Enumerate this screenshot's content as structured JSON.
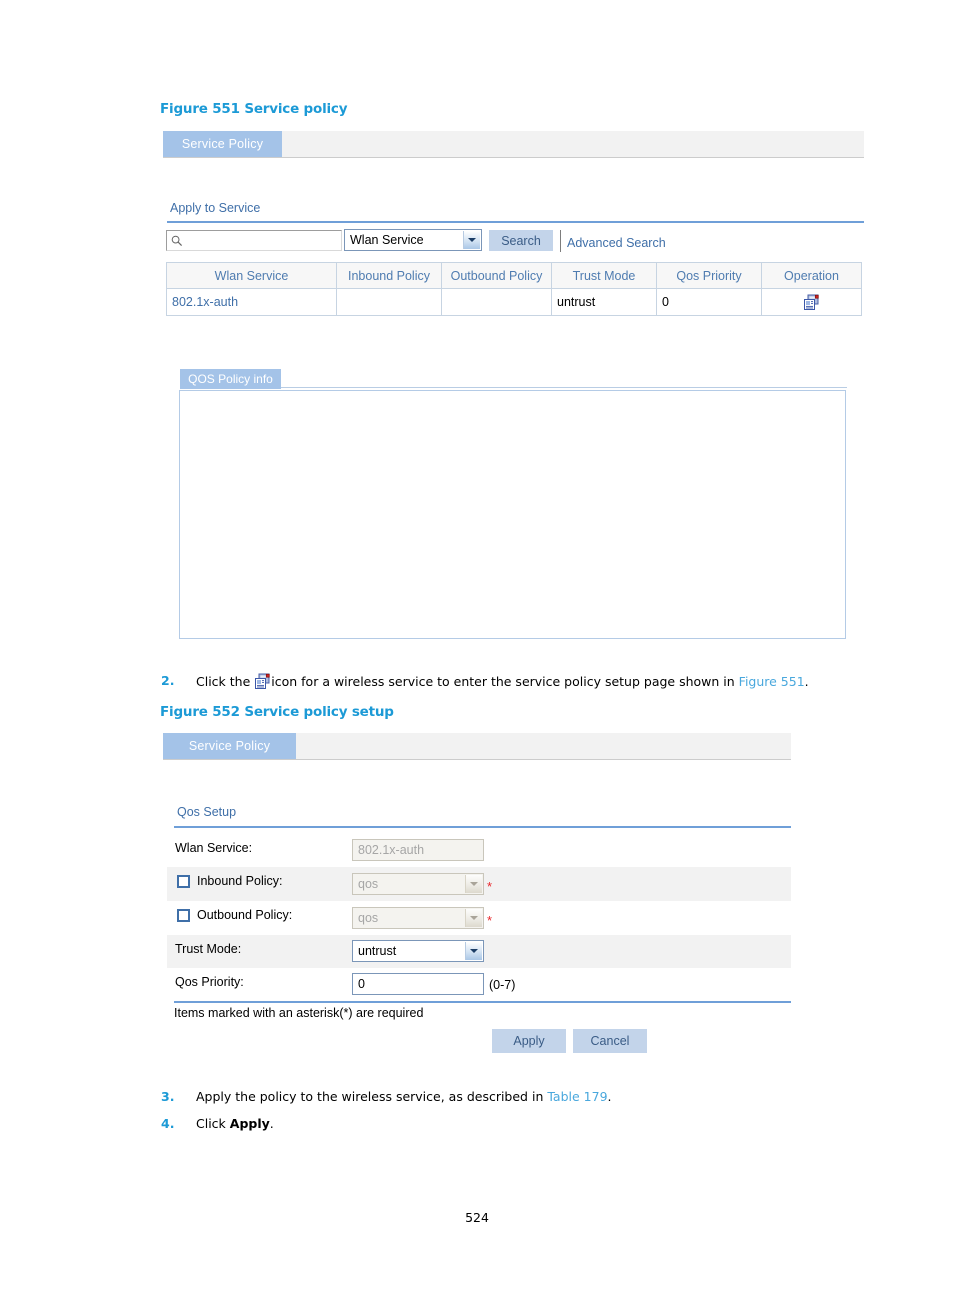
{
  "document": {
    "page_number": "524"
  },
  "figure551": {
    "caption": "Figure 551 Service policy",
    "tab_label": "Service Policy",
    "section_label": "Apply to Service",
    "search": {
      "input_value": "",
      "placeholder": "",
      "search_icon": "search-icon",
      "filter_selected": "Wlan Service",
      "search_button": "Search",
      "advanced_search": "Advanced Search"
    },
    "table": {
      "columns": [
        "Wlan Service",
        "Inbound Policy",
        "Outbound Policy",
        "Trust Mode",
        "Qos Priority",
        "Operation"
      ],
      "rows": [
        {
          "wlan_service": "802.1x-auth",
          "inbound_policy": "",
          "outbound_policy": "",
          "trust_mode": "untrust",
          "qos_priority": "0",
          "operation_icon": "service-policy-setup-icon"
        }
      ]
    },
    "qos_panel": {
      "tab_label": "QOS Policy info",
      "body_text": ""
    }
  },
  "step2": {
    "number": "2.",
    "text_before_icon": "Click the",
    "icon_name": "service-policy-setup-icon",
    "text_after_icon": "icon for a wireless service to enter the service policy setup page shown in",
    "xref": "Figure 551",
    "text_end": "."
  },
  "figure552": {
    "caption": "Figure 552 Service policy setup",
    "tab_label": "Service Policy",
    "section_label": "Qos Setup",
    "fields": [
      {
        "label": "Wlan Service:",
        "type": "text",
        "value": "802.1x-auth",
        "disabled": true,
        "checkbox": false,
        "required": false,
        "hint": ""
      },
      {
        "label": "Inbound Policy:",
        "type": "select",
        "value": "qos",
        "disabled": true,
        "checkbox": true,
        "checked": false,
        "required": true,
        "hint": ""
      },
      {
        "label": "Outbound Policy:",
        "type": "select",
        "value": "qos",
        "disabled": true,
        "checkbox": true,
        "checked": false,
        "required": true,
        "hint": ""
      },
      {
        "label": "Trust Mode:",
        "type": "select",
        "value": "untrust",
        "disabled": false,
        "checkbox": false,
        "required": false,
        "hint": ""
      },
      {
        "label": "Qos Priority:",
        "type": "text",
        "value": "0",
        "disabled": false,
        "checkbox": false,
        "required": false,
        "hint": "(0-7)"
      }
    ],
    "required_note": "Items marked with an asterisk(*) are required",
    "apply_button": "Apply",
    "cancel_button": "Cancel"
  },
  "step3": {
    "number": "3.",
    "text_before": "Apply the policy to the wireless service, as described in",
    "xref": "Table 179",
    "text_end": "."
  },
  "step4": {
    "number": "4.",
    "text_before": "Click",
    "bold_text": "Apply",
    "text_end": "."
  },
  "colors": {
    "caption_blue": "#1c9ad6",
    "tab_blue": "#a4c3e8",
    "section_blue": "#3f6fa8",
    "rule_blue": "#6f9fd8",
    "required_red": "#e8262a",
    "button_blue": "#c3d4ea"
  }
}
